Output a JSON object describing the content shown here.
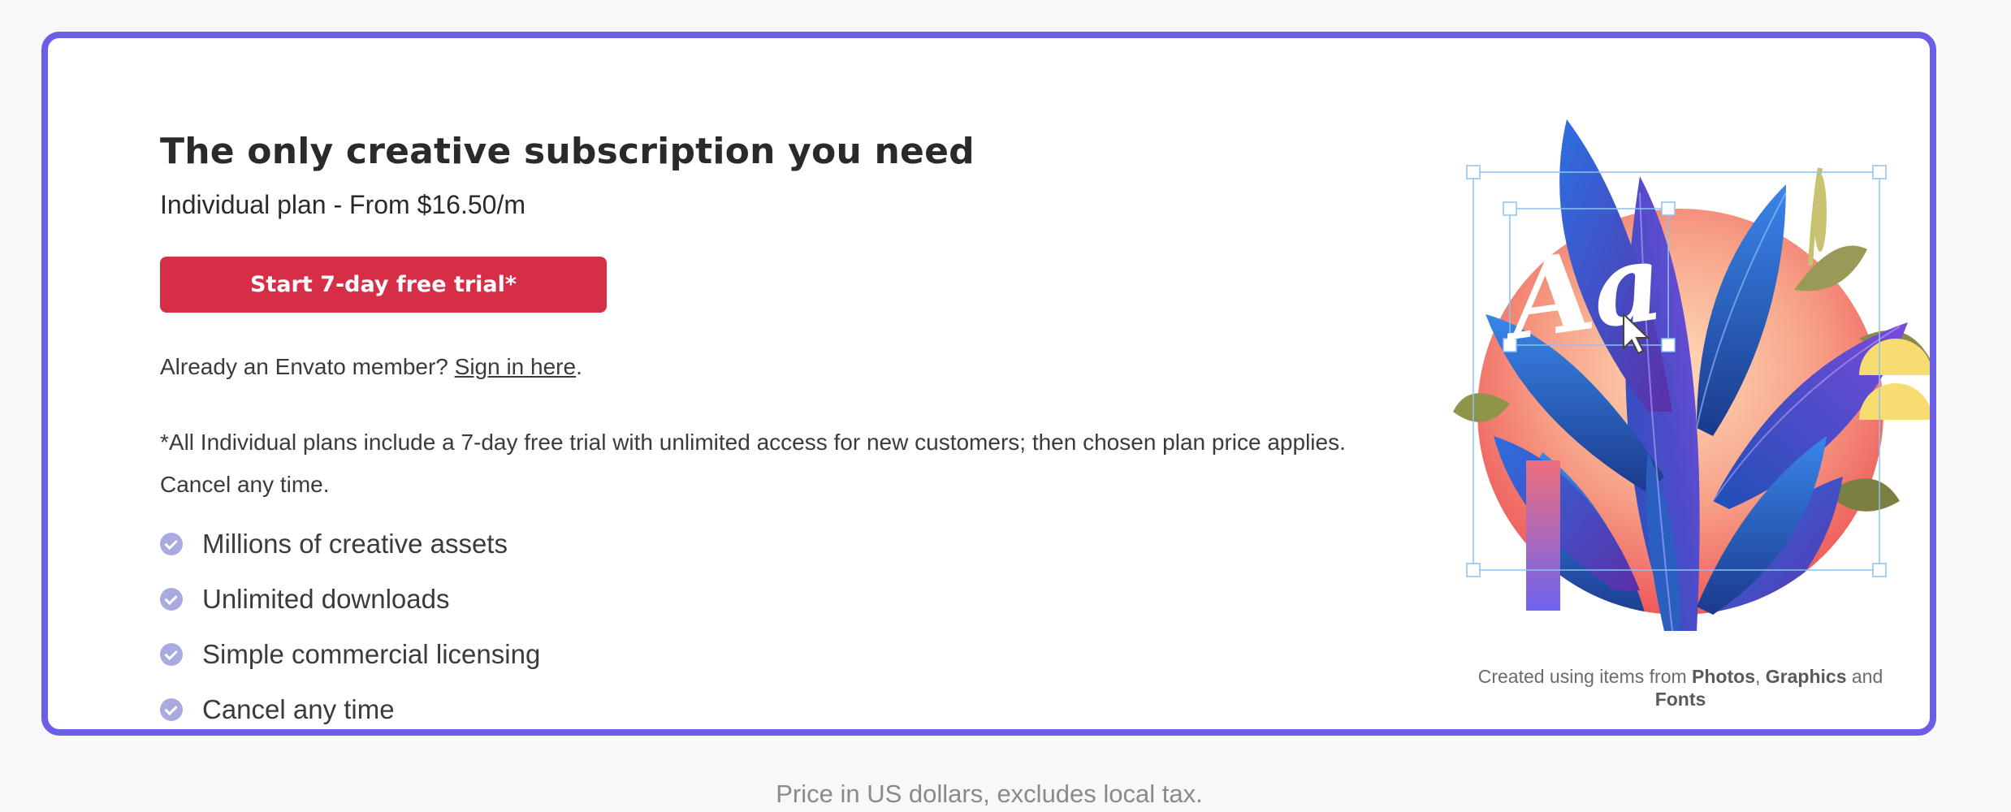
{
  "hero": {
    "title": "The only creative subscription you need",
    "plan_text": "Individual plan - From $16.50/m",
    "cta_label": "Start 7-day free trial*",
    "member_prefix": "Already an Envato member? ",
    "signin_link": "Sign in here",
    "member_suffix": ".",
    "disclaimer": "*All Individual plans include a 7-day free trial with unlimited access for new customers; then chosen plan price applies. Cancel any time.",
    "features": [
      {
        "label": "Millions of creative assets"
      },
      {
        "label": "Unlimited downloads"
      },
      {
        "label": "Simple commercial licensing"
      },
      {
        "label": "Cancel any time"
      }
    ]
  },
  "artwork": {
    "glyph_text": "Aa",
    "credit_prefix": "Created using items from ",
    "credit_item_1": "Photos",
    "credit_sep": ", ",
    "credit_item_2": "Graphics",
    "credit_and": " and",
    "credit_item_3": "Fonts"
  },
  "footer": {
    "price_note": "Price in US dollars, excludes local tax."
  },
  "colors": {
    "frame": "#6a5fe6",
    "cta": "#d72e48",
    "check": "#a9abe0"
  }
}
